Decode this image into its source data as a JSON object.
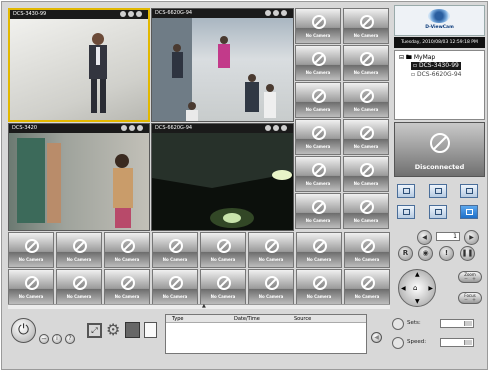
{
  "app": {
    "brand": "D-ViewCam"
  },
  "clock": "Tuesday, 2010/08/03 12:59:18 PM",
  "cameras": {
    "cam1": "DCS-3430-99",
    "cam2": "DCS-6620G-94",
    "cam3": "DCS-3420",
    "cam4": "DCS-6620G-94"
  },
  "no_camera_label": "No Camera",
  "tree": {
    "root": "MyMap",
    "items": [
      "DCS-3430-99",
      "DCS-6620G-94"
    ]
  },
  "status": {
    "disconnected": "Disconnected"
  },
  "ptz": {
    "zoom": "Zoom",
    "focus": "Focus"
  },
  "controls": {
    "sets_label": "Sets:",
    "speed_label": "Speed:",
    "page_value": "1"
  },
  "log": {
    "columns": [
      "Type",
      "Date/Time",
      "Source"
    ]
  },
  "colors": {
    "selected_border": "#e2b800",
    "layout_selected": "#1d6fc8",
    "brand_blue": "#0a3a7a"
  },
  "icons": [
    "power-icon",
    "minimize-icon",
    "info-icon",
    "help-icon",
    "fullscreen-icon",
    "settings-gear-icon",
    "playback-icon",
    "report-icon",
    "eye-logo-icon"
  ]
}
